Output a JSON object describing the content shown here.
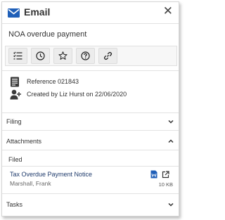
{
  "header": {
    "title": "Email",
    "close_label": "✕",
    "icon": "envelope-icon"
  },
  "subject": "NOA overdue payment",
  "toolbar": {
    "buttons": [
      {
        "icon": "checklist-icon"
      },
      {
        "icon": "clock-icon"
      },
      {
        "icon": "star-icon"
      },
      {
        "icon": "help-icon"
      },
      {
        "icon": "link-icon"
      }
    ]
  },
  "details": {
    "reference": "Reference 021843",
    "created": "Created by Liz Hurst on 22/06/2020"
  },
  "sections": {
    "filing": {
      "label": "Filing",
      "expanded": false
    },
    "attachments": {
      "label": "Attachments",
      "expanded": true
    },
    "tasks": {
      "label": "Tasks",
      "expanded": false
    }
  },
  "attachments": {
    "group_label": "Filed",
    "items": [
      {
        "title": "Tax Overdue Payment Notice",
        "author": "Marshall, Frank",
        "size": "10 KB"
      }
    ]
  },
  "colors": {
    "accent": "#1f5fb8",
    "link": "#1e3a6b"
  }
}
